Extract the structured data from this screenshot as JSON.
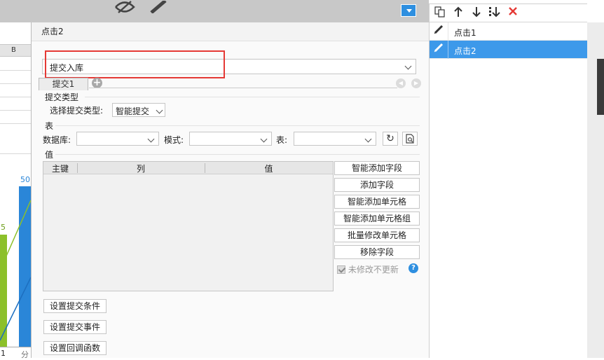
{
  "dialog": {
    "title": "点击2",
    "submit_type_select": {
      "value": "提交入库"
    },
    "tabs": [
      {
        "label": "提交1"
      }
    ],
    "submit_type_section": {
      "header": "提交类型",
      "label": "选择提交类型:",
      "value": "智能提交"
    },
    "table_section": {
      "header": "表",
      "db_label": "数据库:",
      "mode_label": "模式:",
      "table_label": "表:"
    },
    "value_section": {
      "header": "值",
      "columns": [
        "主键",
        "列",
        "值"
      ],
      "buttons": [
        "智能添加字段",
        "添加字段",
        "智能添加单元格",
        "智能添加单元格组",
        "批量修改单元格",
        "移除字段"
      ],
      "checkbox_label": "未修改不更新",
      "help": "?"
    },
    "bottom_buttons": [
      "设置提交条件",
      "设置提交事件",
      "设置回调函数"
    ]
  },
  "right_panel": {
    "items": [
      {
        "label": "点击1",
        "selected": false
      },
      {
        "label": "点击2",
        "selected": true
      }
    ]
  },
  "background": {
    "column_header": "B",
    "chart_labels": {
      "green": "5",
      "blue": "50"
    },
    "axis_labels": [
      "1",
      "分"
    ]
  },
  "colors": {
    "accent": "#3d99ea",
    "highlight_frame": "#e53935",
    "bar_green": "#8cc02a",
    "bar_blue": "#2a86d8",
    "delete_red": "#e53935"
  }
}
